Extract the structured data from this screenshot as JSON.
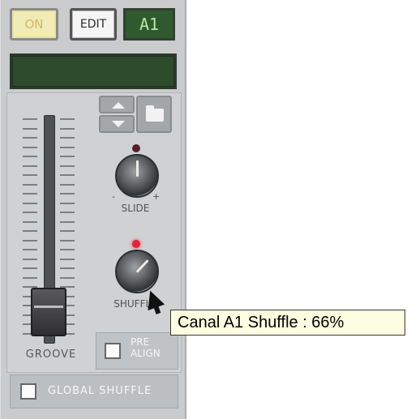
{
  "topbar": {
    "on_label": "ON",
    "edit_label": "EDIT",
    "channel_display": "A1"
  },
  "controls": {
    "groove_label": "GROOVE",
    "slide": {
      "label": "SLIDE",
      "minus": "-",
      "plus": "+"
    },
    "shuffle": {
      "label": "SHUFFLE",
      "value_percent": 66
    },
    "prealign_label": "PRE\nALIGN",
    "global_shuffle_label": "GLOBAL SHUFFLE"
  },
  "tooltip": {
    "text": "Canal A1 Shuffle : 66%"
  },
  "colors": {
    "panel_bg": "#c9cbcd",
    "lcd_green": "#2e4b2b",
    "led_red": "#e3233a",
    "tooltip_bg": "#fdfde1"
  },
  "icons": [
    "arrow-up-icon",
    "arrow-down-icon",
    "folder-icon",
    "mouse-cursor-icon"
  ]
}
